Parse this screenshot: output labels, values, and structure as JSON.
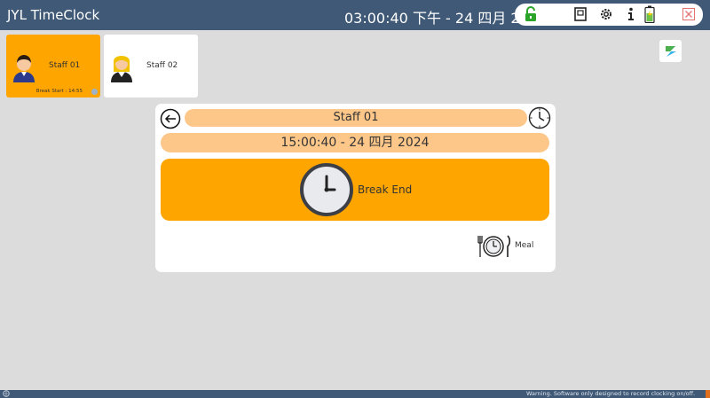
{
  "app": {
    "title": "JYL TimeClock",
    "datetime": "03:00:40 下午 - 24 四月 2024"
  },
  "tray": {
    "icons": [
      "unlock-icon",
      "door-icon",
      "gear-icon",
      "info-icon",
      "battery-icon",
      "close-icon"
    ]
  },
  "staff": [
    {
      "name": "Staff 01",
      "status": "Break Start : 14:55",
      "color": "#ffa500"
    },
    {
      "name": "Staff 02",
      "status": "",
      "color": "#ffffff"
    }
  ],
  "panel": {
    "name": "Staff 01",
    "datetime": "15:00:40 - 24 四月 2024",
    "action_label": "Break End",
    "meal_label": "Meal"
  },
  "footer": {
    "warning": "Warning. Software only designed to record clocking on/off."
  },
  "colors": {
    "titlebar": "#3f5977",
    "accent_orange": "#ffa500",
    "soft_orange": "#fdc78a",
    "background": "#dcdcdc"
  }
}
